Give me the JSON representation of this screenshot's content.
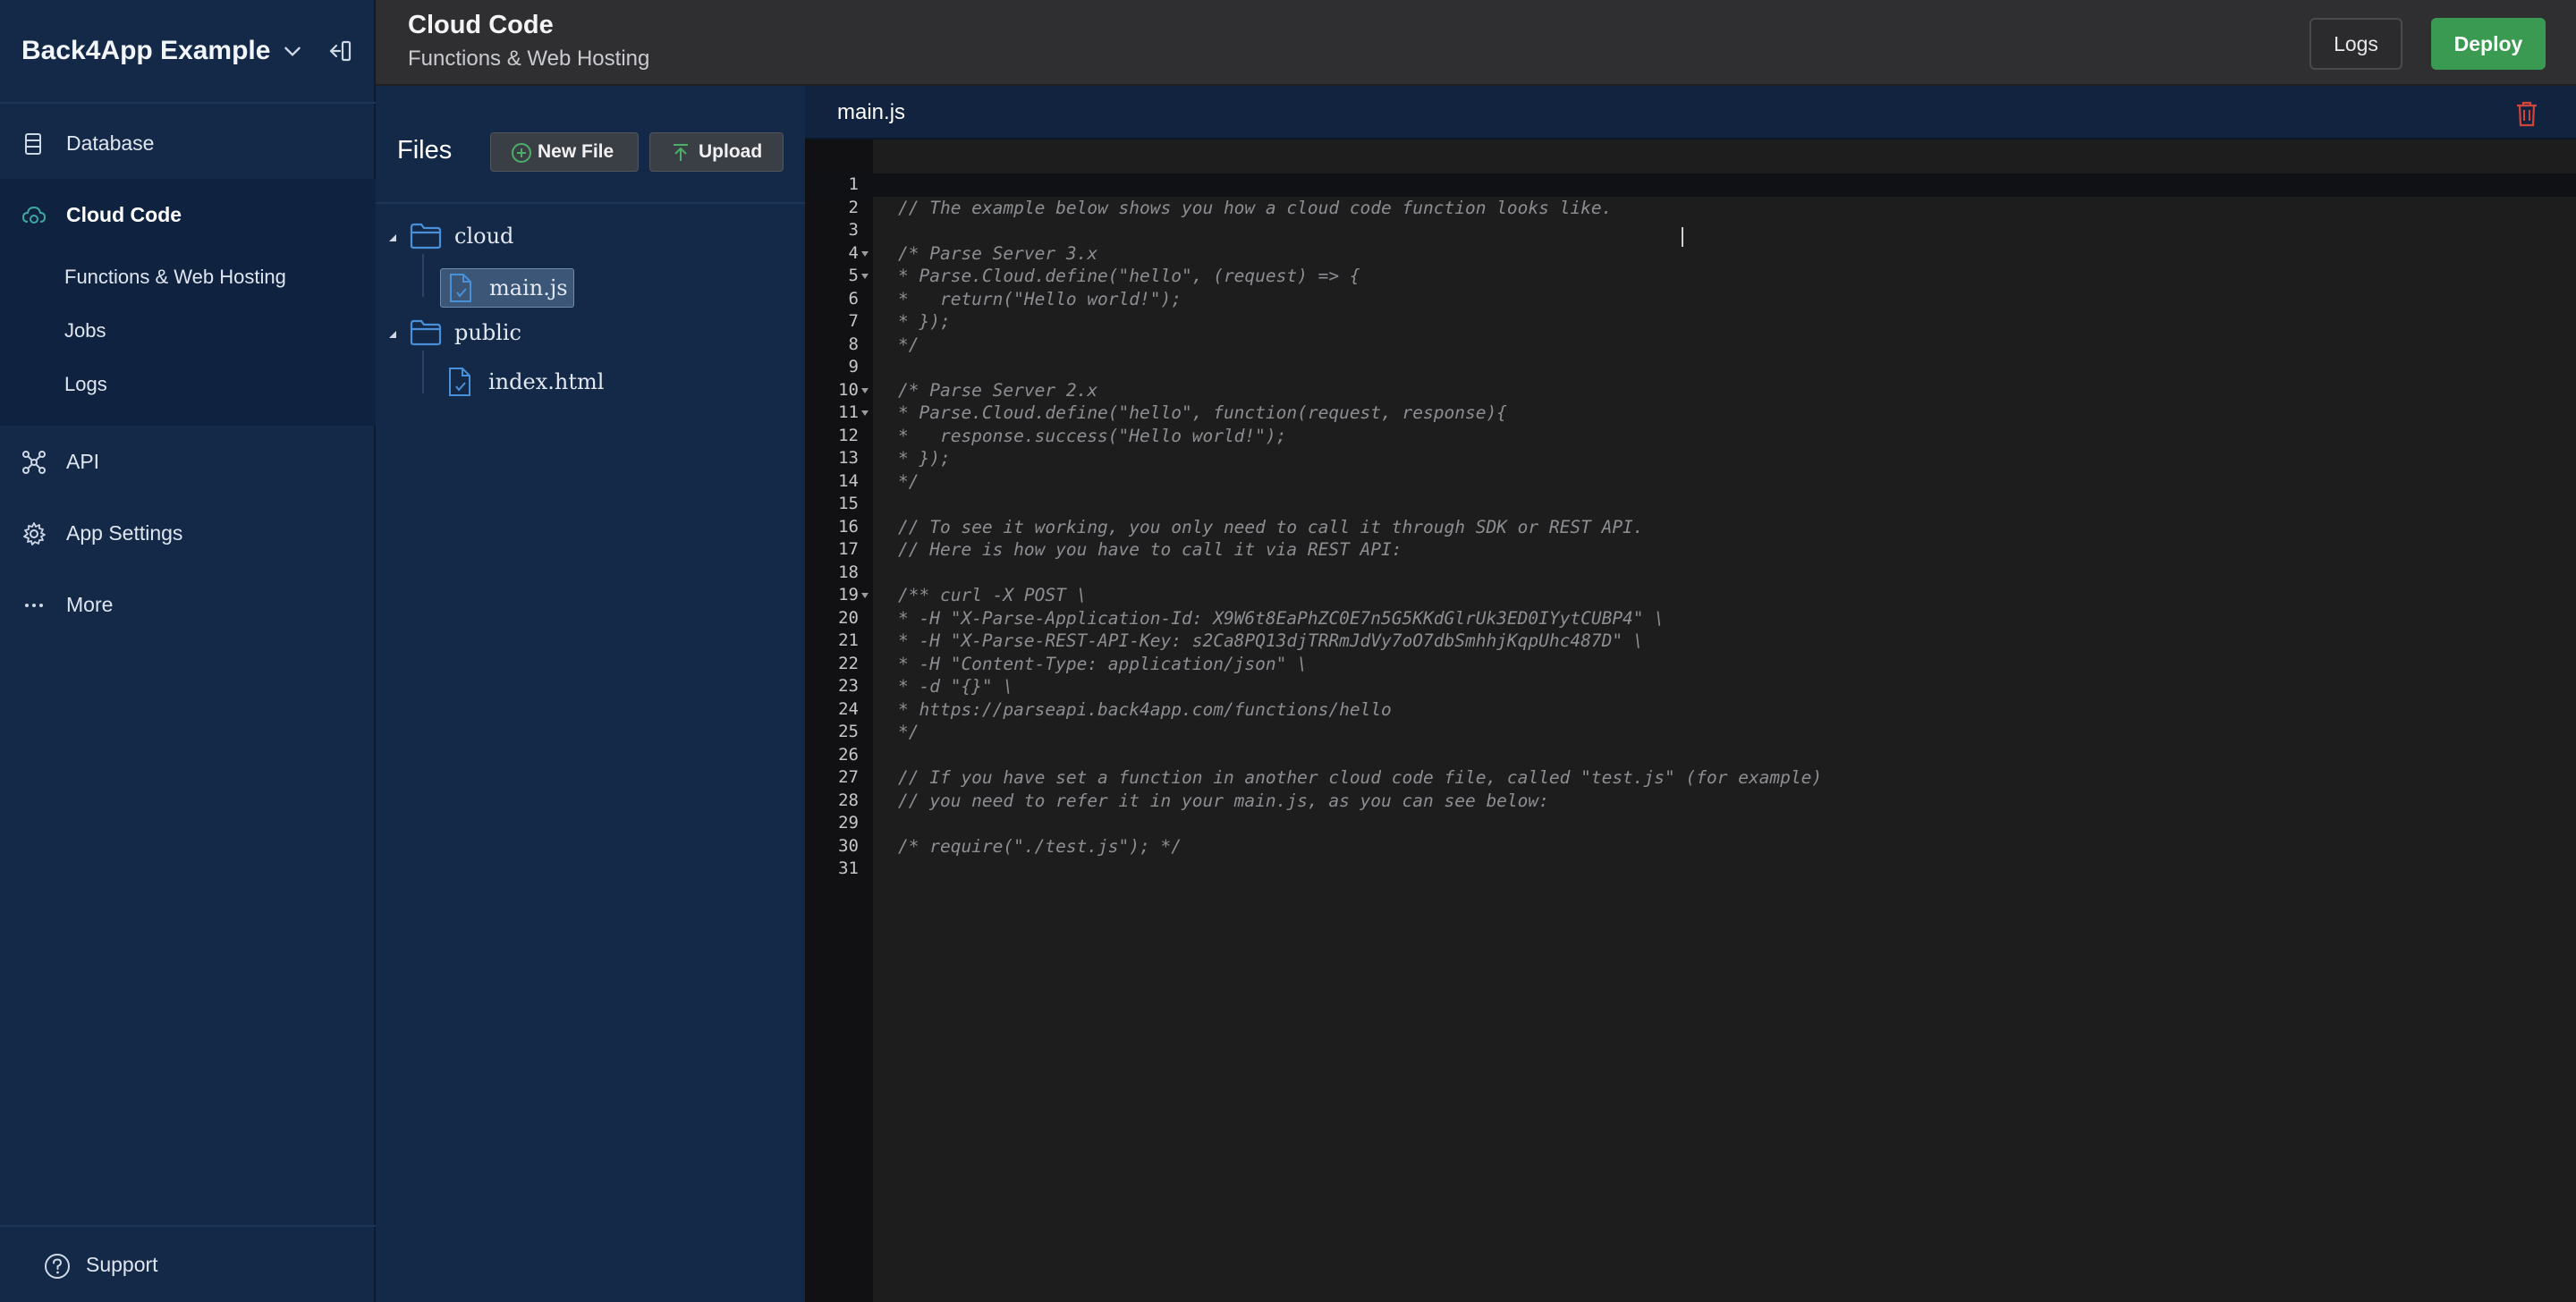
{
  "sidebar": {
    "app_name": "Back4App Example",
    "items": [
      {
        "label": "Database",
        "icon": "database-icon"
      },
      {
        "label": "Cloud Code",
        "icon": "cloud-code-icon",
        "active": true
      },
      {
        "label": "API",
        "icon": "api-icon"
      },
      {
        "label": "App Settings",
        "icon": "gear-icon"
      },
      {
        "label": "More",
        "icon": "more-icon"
      }
    ],
    "cloud_code_subitems": [
      "Functions & Web Hosting",
      "Jobs",
      "Logs"
    ],
    "support_label": "Support"
  },
  "header": {
    "title": "Cloud Code",
    "subtitle": "Functions & Web Hosting",
    "logs_label": "Logs",
    "deploy_label": "Deploy",
    "deploy_color": "#3a9a52"
  },
  "files": {
    "title": "Files",
    "new_file_label": "New File",
    "upload_label": "Upload",
    "tree": {
      "cloud": {
        "name": "cloud",
        "files": [
          "main.js"
        ]
      },
      "public": {
        "name": "public",
        "files": [
          "index.html"
        ]
      }
    },
    "selected": "main.js"
  },
  "editor": {
    "filename": "main.js",
    "lines": [
      "",
      "// The example below shows you how a cloud code function looks like.",
      "",
      "/* Parse Server 3.x",
      "* Parse.Cloud.define(\"hello\", (request) => {",
      "*   return(\"Hello world!\");",
      "* });",
      "*/",
      "",
      "/* Parse Server 2.x",
      "* Parse.Cloud.define(\"hello\", function(request, response){",
      "*   response.success(\"Hello world!\");",
      "* });",
      "*/",
      "",
      "// To see it working, you only need to call it through SDK or REST API.",
      "// Here is how you have to call it via REST API:",
      "",
      "/** curl -X POST \\",
      "* -H \"X-Parse-Application-Id: X9W6t8EaPhZC0E7n5G5KKdGlrUk3ED0IYytCUBP4\" \\",
      "* -H \"X-Parse-REST-API-Key: s2Ca8PQ13djTRRmJdVy7oO7dbSmhhjKqpUhc487D\" \\",
      "* -H \"Content-Type: application/json\" \\",
      "* -d \"{}\" \\",
      "* https://parseapi.back4app.com/functions/hello",
      "*/",
      "",
      "// If you have set a function in another cloud code file, called \"test.js\" (for example)",
      "// you need to refer it in your main.js, as you can see below:",
      "",
      "/* require(\"./test.js\"); */",
      ""
    ],
    "line_numbers": [
      "1",
      "2",
      "3",
      "4",
      "5",
      "6",
      "7",
      "8",
      "9",
      "10",
      "11",
      "12",
      "13",
      "14",
      "15",
      "16",
      "17",
      "18",
      "19",
      "20",
      "21",
      "22",
      "23",
      "24",
      "25",
      "26",
      "27",
      "28",
      "29",
      "30",
      "31"
    ],
    "foldable_lines": [
      4,
      5,
      10,
      11,
      19
    ]
  }
}
